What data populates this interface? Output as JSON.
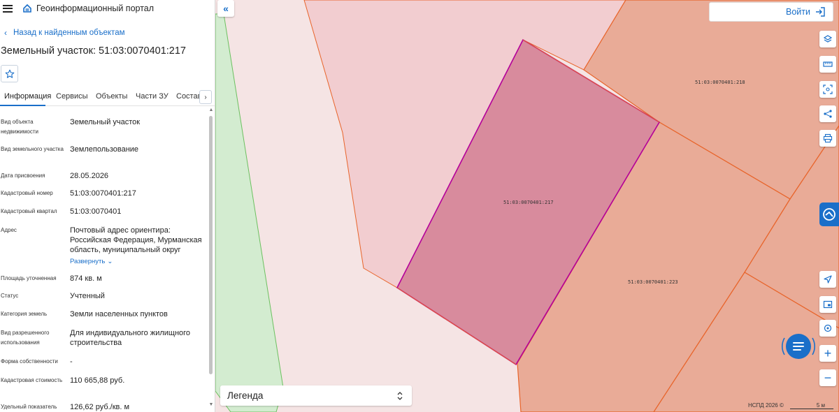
{
  "header": {
    "portal_title": "Геоинформационный портал"
  },
  "nav": {
    "back_label": "Назад к найденным объектам"
  },
  "object": {
    "title": "Земельный участок: 51:03:0070401:217"
  },
  "tabs": [
    {
      "label": "Информация",
      "active": true
    },
    {
      "label": "Сервисы"
    },
    {
      "label": "Объекты"
    },
    {
      "label": "Части ЗУ"
    },
    {
      "label": "Состав"
    }
  ],
  "properties": [
    {
      "key": "Вид объекта недвижимости",
      "value": "Земельный участок"
    },
    {
      "key": "Вид земельного участка",
      "value": "Землепользование"
    },
    {
      "key": "Дата присвоения",
      "value": "28.05.2026"
    },
    {
      "key": "Кадастровый номер",
      "value": "51:03:0070401:217"
    },
    {
      "key": "Кадастровый квартал",
      "value": "51:03:0070401"
    },
    {
      "key": "Адрес",
      "value": "Почтовый адрес ориентира: Российская Федерация, Мурманская область, муниципальный округ",
      "expand_label": "Развернуть"
    },
    {
      "key": "Площадь уточненная",
      "value": "874 кв. м"
    },
    {
      "key": "Статус",
      "value": "Учтенный"
    },
    {
      "key": "Категория земель",
      "value": "Земли населенных пунктов"
    },
    {
      "key": "Вид разрешенного использования",
      "value": "Для индивидуального жилищного строительства"
    },
    {
      "key": "Форма собственности",
      "value": "-"
    },
    {
      "key": "Кадастровая стоимость",
      "value": "110 665,88 руб."
    },
    {
      "key": "Удельный показатель",
      "value": "126,62 руб./кв. м"
    }
  ],
  "map": {
    "login_label": "Войти",
    "legend_label": "Легенда",
    "attribution": "НСПД 2026 ©",
    "scale_label": "5 м",
    "parcel_labels": [
      "51:03:0070401:217",
      "51:03:0070401:218",
      "51:03:0070401:223"
    ],
    "tools": [
      "layers-icon",
      "ruler-icon",
      "select-area-icon",
      "share-icon",
      "print-icon",
      "locate-icon",
      "minimap-icon",
      "geolocation-icon",
      "zoom-in-icon",
      "zoom-out-icon"
    ],
    "colors": {
      "selected_fill": "#d88b9d",
      "selected_stroke": "#b4009a",
      "neighbor_fill": "#e9ab97",
      "neighbor_stroke": "#e8642a",
      "green_zone": "#d3ecd0",
      "accent": "#1a6fc9"
    }
  }
}
